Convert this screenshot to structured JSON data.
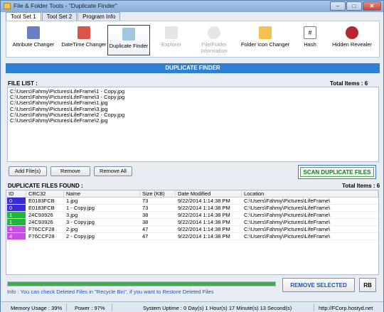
{
  "window": {
    "title": "File & Folder Tools - \"Duplicate Finder\""
  },
  "window_controls": {
    "minimize": "‒",
    "maximize": "□",
    "close": "✕"
  },
  "tabs": [
    {
      "label": "Tool Set 1",
      "active": true
    },
    {
      "label": "Tool Set 2",
      "active": false
    },
    {
      "label": "Program Info",
      "active": false
    }
  ],
  "tools": [
    {
      "label": "Attribute Changer",
      "icon": "attribute-icon",
      "color": "#6b7fc4"
    },
    {
      "label": "DateTime Changer",
      "icon": "calendar-icon",
      "color": "#d9554a"
    },
    {
      "label": "Duplicate Finder",
      "icon": "duplicate-files-icon",
      "color": "#9fc8e0",
      "selected": true
    },
    {
      "label": "Explorer",
      "icon": "explorer-icon",
      "color": "#e3e6ea",
      "disabled": true
    },
    {
      "label": "File/Folder",
      "label2": "Information",
      "icon": "info-icon",
      "color": "#e3e6ea",
      "disabled": true
    },
    {
      "label": "Folder Icon Changer",
      "icon": "folder-icon",
      "color": "#f2c14e"
    },
    {
      "label": "Hash",
      "icon": "hash-icon",
      "color": "#ffffff"
    },
    {
      "label": "Hidden Revealer",
      "icon": "gear-red-icon",
      "color": "#b3282e"
    }
  ],
  "header": {
    "title": "DUPLICATE FINDER"
  },
  "file_list": {
    "label": "FILE LIST :",
    "total": "Total Items : 6",
    "items": [
      "C:\\Users\\Fahmy\\Pictures\\LifeFrame\\1 - Copy.jpg",
      "C:\\Users\\Fahmy\\Pictures\\LifeFrame\\3 - Copy.jpg",
      "C:\\Users\\Fahmy\\Pictures\\LifeFrame\\1.jpg",
      "C:\\Users\\Fahmy\\Pictures\\LifeFrame\\3.jpg",
      "C:\\Users\\Fahmy\\Pictures\\LifeFrame\\2 - Copy.jpg",
      "C:\\Users\\Fahmy\\Pictures\\LifeFrame\\2.jpg"
    ]
  },
  "buttons": {
    "add_files": "Add File(s)",
    "remove": "Remove",
    "remove_all": "Remove All",
    "scan": "SCAN DUPLICATE FILES",
    "remove_selected": "REMOVE SELECTED",
    "rb": "RB"
  },
  "duplicates": {
    "label": "DUPLICATE FILES FOUND :",
    "total": "Total Items : 6",
    "columns": [
      "ID",
      "CRC32",
      "Name",
      "Size (KB)",
      "Date Modified",
      "Location"
    ],
    "rows": [
      {
        "id": "0",
        "crc": "E0183FCB",
        "name": "1.jpg",
        "size": "73",
        "date": "9/22/2014 1:14:38 PM",
        "location": "C:\\Users\\Fahmy\\Pictures\\LifeFrame\\",
        "color": "#3a2bd6"
      },
      {
        "id": "0",
        "crc": "E0183FCB",
        "name": "1 - Copy.jpg",
        "size": "73",
        "date": "9/22/2014 1:14:38 PM",
        "location": "C:\\Users\\Fahmy\\Pictures\\LifeFrame\\",
        "color": "#3a2bd6"
      },
      {
        "id": "1",
        "crc": "24C93926",
        "name": "3.jpg",
        "size": "38",
        "date": "9/22/2014 1:14:38 PM",
        "location": "C:\\Users\\Fahmy\\Pictures\\LifeFrame\\",
        "color": "#27b33a"
      },
      {
        "id": "1",
        "crc": "24C93926",
        "name": "3 - Copy.jpg",
        "size": "38",
        "date": "9/22/2014 1:14:38 PM",
        "location": "C:\\Users\\Fahmy\\Pictures\\LifeFrame\\",
        "color": "#27b33a"
      },
      {
        "id": "4",
        "crc": "F76CCF28",
        "name": "2.jpg",
        "size": "47",
        "date": "9/22/2014 1:14:38 PM",
        "location": "C:\\Users\\Fahmy\\Pictures\\LifeFrame\\",
        "color": "#c44fe0"
      },
      {
        "id": "4",
        "crc": "F76CCF28",
        "name": "2 - Copy.jpg",
        "size": "47",
        "date": "9/22/2014 1:14:38 PM",
        "location": "C:\\Users\\Fahmy\\Pictures\\LifeFrame\\",
        "color": "#c44fe0"
      }
    ]
  },
  "progress": {
    "value": 1.0,
    "color": "#3cb043"
  },
  "info": "Info : You can check Deleted Files in \"Recycle Bin\", if you want to Restore Deleted Files",
  "status": {
    "memory": "Memory Usage : 39%",
    "power": "Power : 97%",
    "uptime": "System Uptime : 0 Day(s) 1 Hour(s) 17 Minute(s) 13 Second(s)",
    "url": "http://FCorp.hostyd.net"
  }
}
